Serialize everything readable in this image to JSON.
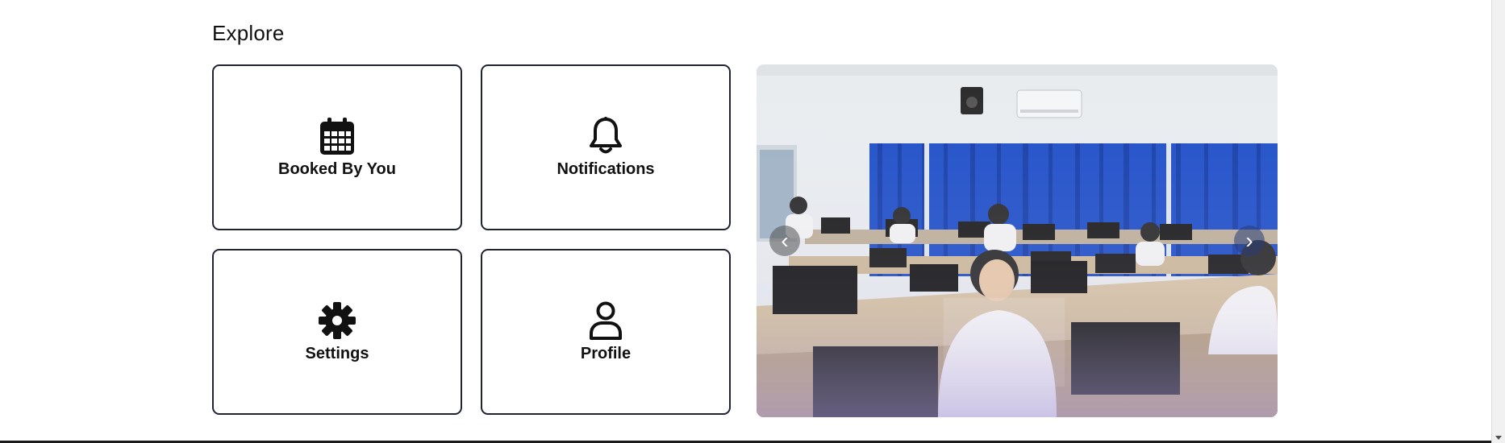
{
  "section": {
    "title": "Explore"
  },
  "tiles": [
    {
      "label": "Booked By You",
      "icon": "calendar-icon"
    },
    {
      "label": "Notifications",
      "icon": "bell-icon"
    },
    {
      "label": "Settings",
      "icon": "gear-icon"
    },
    {
      "label": "Profile",
      "icon": "person-icon"
    }
  ],
  "carousel": {
    "prev_glyph": "‹",
    "next_glyph": "›",
    "image_subject": "computer-lab-classroom-photo"
  },
  "colors": {
    "tile_border": "#1f2430",
    "curtain_blue": "#1f4fc8",
    "text": "#111111"
  }
}
